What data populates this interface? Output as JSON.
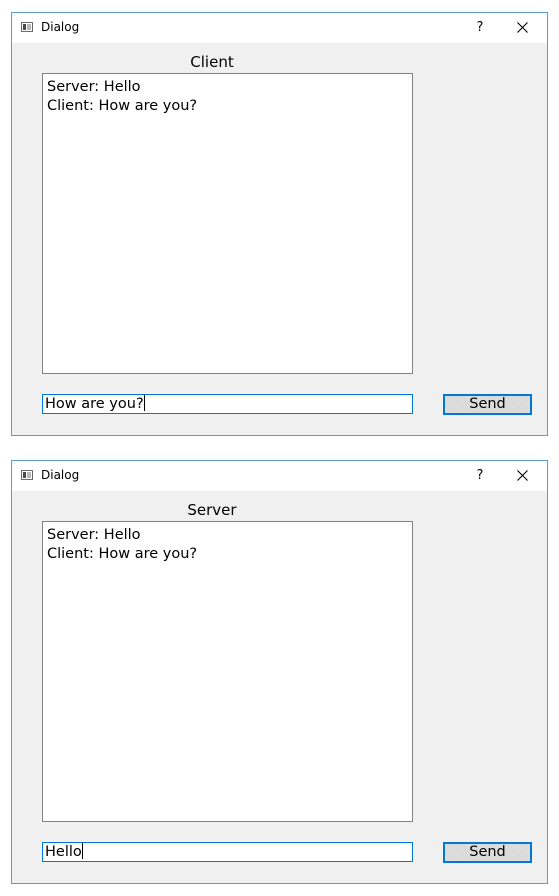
{
  "dialogs": [
    {
      "window_title": "Dialog",
      "help_label": "?",
      "caption": "Client",
      "chat_lines": [
        "Server: Hello",
        "Client: How are you?"
      ],
      "input_value": "How are you?",
      "send_label": "Send"
    },
    {
      "window_title": "Dialog",
      "help_label": "?",
      "caption": "Server",
      "chat_lines": [
        "Server: Hello",
        "Client: How are you?"
      ],
      "input_value": "Hello",
      "send_label": "Send"
    }
  ],
  "icons": {
    "app": "window-app-icon",
    "close": "close-icon"
  },
  "colors": {
    "accent": "#0078d7",
    "window_border": "#5b9bd5",
    "dialog_bg": "#f0f0f0"
  }
}
